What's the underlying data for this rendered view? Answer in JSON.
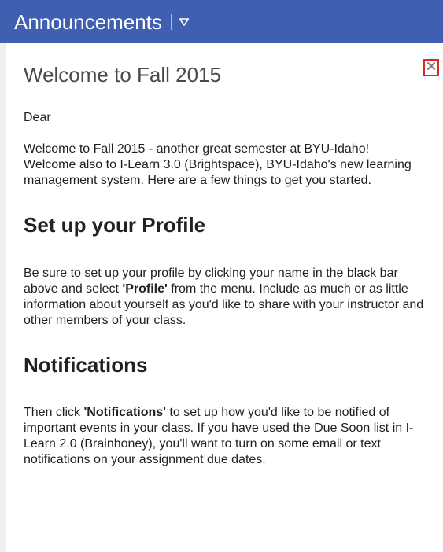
{
  "header": {
    "title": "Announcements"
  },
  "announcement": {
    "title": "Welcome to Fall 2015",
    "greeting": "Dear",
    "intro": "Welcome to Fall 2015 - another great semester at BYU-Idaho! Welcome also to I-Learn 3.0 (Brightspace), BYU-Idaho's new learning management system. Here are a few things to get you started.",
    "profile_section": {
      "heading": "Set up your Profile",
      "text_before": "Be sure to set up your profile by clicking your name in the black bar above and select ",
      "bold": "'Profile'",
      "text_after": " from the menu. Include as much or as little information about yourself as you'd like to share with your instructor and other members of your class."
    },
    "notifications_section": {
      "heading": "Notifications",
      "text_before": "Then click ",
      "bold": "'Notifications'",
      "text_after": " to set up how you'd like to be notified of important events in your class. If you have used the Due Soon list in I-Learn 2.0 (Brainhoney), you'll want to turn on some email or text notifications on your assignment due dates."
    }
  },
  "icons": {
    "header_menu": "chevron-down-icon",
    "dismiss": "close-icon"
  },
  "colors": {
    "header_bg": "#3f5fb0",
    "close_border": "#e0261f"
  }
}
